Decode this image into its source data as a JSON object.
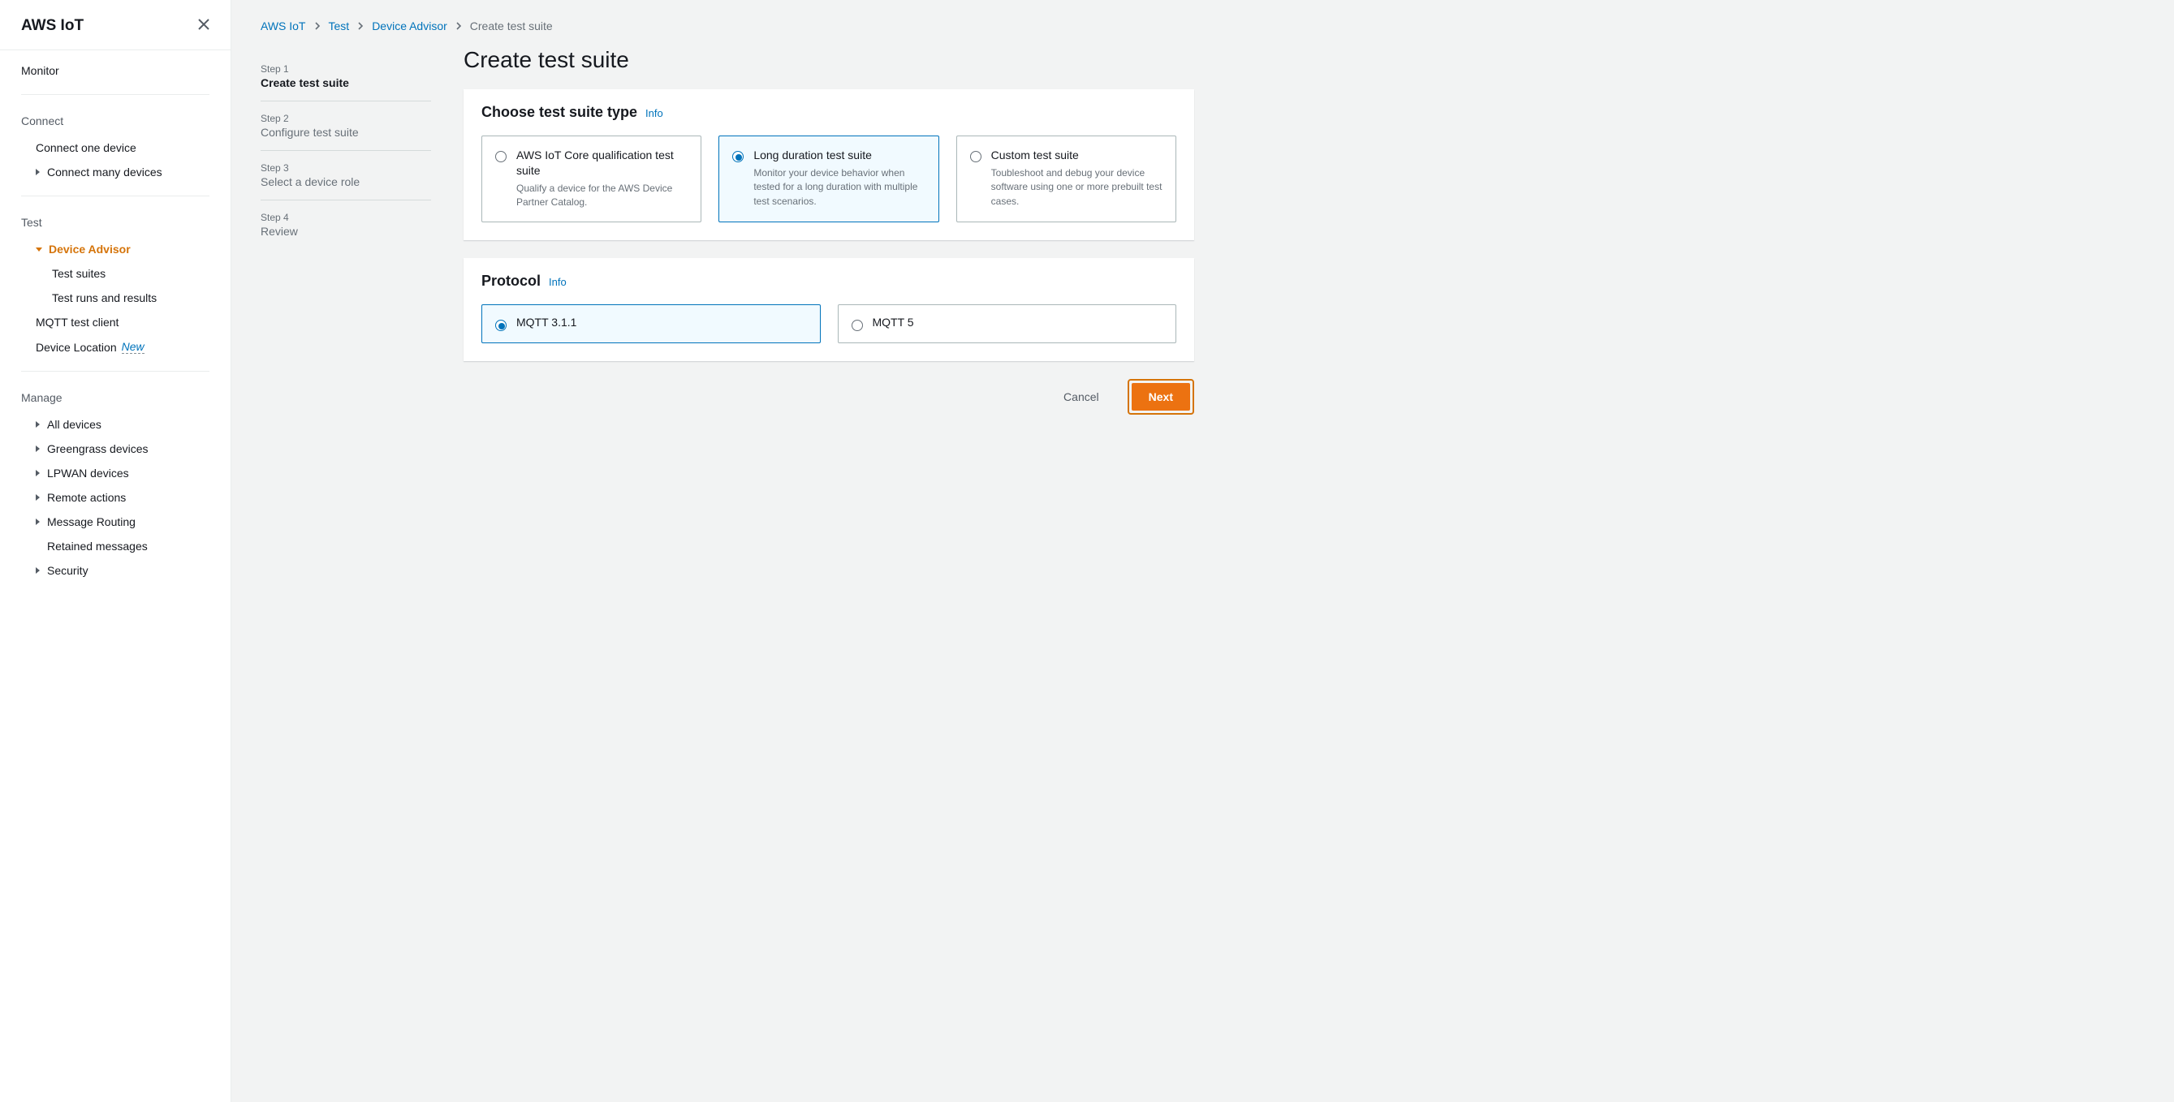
{
  "sidebar": {
    "title": "AWS IoT",
    "monitor": "Monitor",
    "connect_header": "Connect",
    "connect_one": "Connect one device",
    "connect_many": "Connect many devices",
    "test_header": "Test",
    "device_advisor": "Device Advisor",
    "test_suites": "Test suites",
    "test_runs": "Test runs and results",
    "mqtt_client": "MQTT test client",
    "device_location": "Device Location",
    "device_location_badge": "New",
    "manage_header": "Manage",
    "all_devices": "All devices",
    "greengrass": "Greengrass devices",
    "lpwan": "LPWAN devices",
    "remote_actions": "Remote actions",
    "message_routing": "Message Routing",
    "retained_messages": "Retained messages",
    "security": "Security"
  },
  "breadcrumbs": {
    "root": "AWS IoT",
    "test": "Test",
    "da": "Device Advisor",
    "current": "Create test suite"
  },
  "wizard": {
    "s1n": "Step 1",
    "s1t": "Create test suite",
    "s2n": "Step 2",
    "s2t": "Configure test suite",
    "s3n": "Step 3",
    "s3t": "Select a device role",
    "s4n": "Step 4",
    "s4t": "Review"
  },
  "page": {
    "title": "Create test suite",
    "panel1_title": "Choose test suite type",
    "panel2_title": "Protocol",
    "info": "Info",
    "cancel": "Cancel",
    "next": "Next"
  },
  "suite_types": {
    "a_title": "AWS IoT Core qualification test suite",
    "a_desc": "Qualify a device for the AWS Device Partner Catalog.",
    "b_title": "Long duration test suite",
    "b_desc": "Monitor your device behavior when tested for a long duration with multiple test scenarios.",
    "c_title": "Custom test suite",
    "c_desc": "Toubleshoot and debug your device software using one or more prebuilt test cases."
  },
  "protocols": {
    "a": "MQTT 3.1.1",
    "b": "MQTT 5"
  }
}
